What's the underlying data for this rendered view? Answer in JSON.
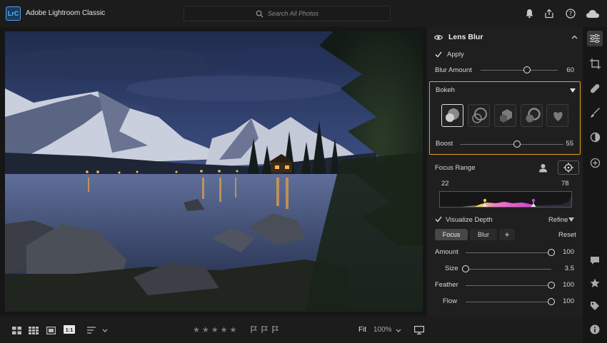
{
  "app": {
    "logo": "LrC",
    "title": "Adobe Lightroom Classic"
  },
  "search": {
    "placeholder": "Search All Photos"
  },
  "lens_blur": {
    "title": "Lens Blur",
    "apply_label": "Apply",
    "blur_amount_label": "Blur Amount",
    "blur_amount_value": "60",
    "blur_amount_level": 0.6,
    "bokeh_label": "Bokeh",
    "boost_label": "Boost",
    "boost_value": "55",
    "boost_level": 0.55,
    "focus_range_label": "Focus Range",
    "range_min": "22",
    "range_max": "78",
    "visualize_label": "Visualize Depth",
    "refine_label": "Refine",
    "tabs": {
      "focus": "Focus",
      "blur": "Blur",
      "add": "+"
    },
    "reset_label": "Reset",
    "controls": [
      {
        "label": "Amount",
        "value": "100",
        "level": 1.0
      },
      {
        "label": "Size",
        "value": "3.5",
        "level": 0.0
      },
      {
        "label": "Feather",
        "value": "100",
        "level": 1.0
      },
      {
        "label": "Flow",
        "value": "100",
        "level": 1.0
      }
    ]
  },
  "bottom": {
    "zoom_fit": "Fit",
    "zoom_pct": "100%",
    "one_to_one": "1:1"
  },
  "colors": {
    "accent": "#e3a11d",
    "logo_blue": "#4aa3ff"
  }
}
